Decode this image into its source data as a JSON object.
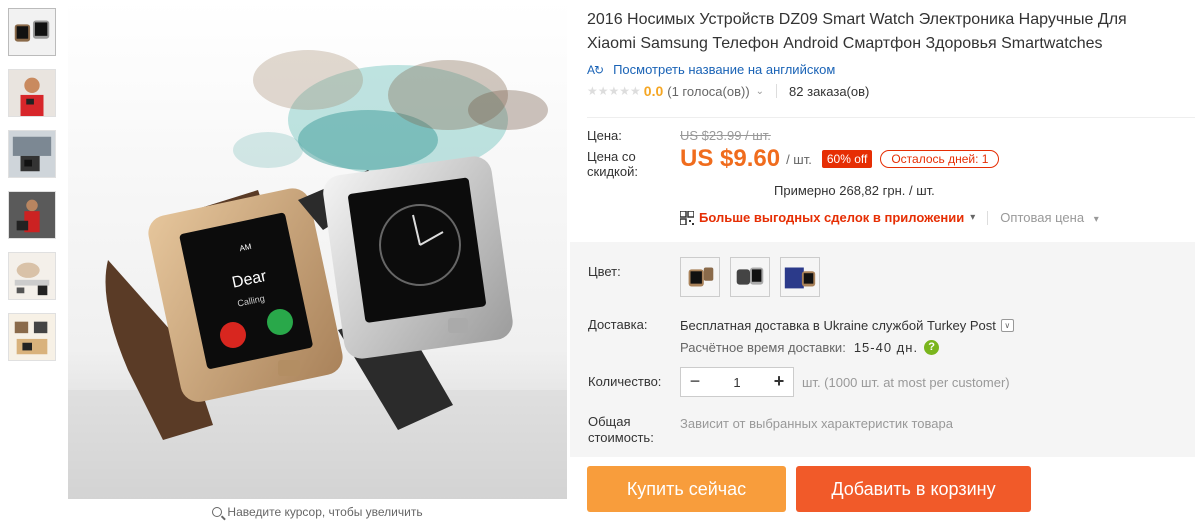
{
  "product": {
    "title": "2016 Носимых Устройств DZ09 Smart Watch Электроника Наручные Для Xiaomi Samsung Телефон Android Смартфон Здоровья Smartwatches",
    "translate_link": "Посмотреть название на английском",
    "translate_icon": "translate-icon"
  },
  "rating": {
    "score": "0.0",
    "votes": "(1 голоса(ов))",
    "orders": "82 заказа(ов)"
  },
  "price": {
    "label_price": "Цена:",
    "old_price": "US $23.99 / шт.",
    "label_discount": "Цена со скидкой:",
    "new_price": "US $9.60",
    "per_unit": "/ шт.",
    "discount_badge": "60% off",
    "days_left": "Осталось дней: 1",
    "approx": "Примерно 268,82 грн. / шт.",
    "app_deals": "Больше выгодных сделок в приложении",
    "wholesale": "Оптовая цена"
  },
  "options": {
    "color_label": "Цвет:",
    "shipping_label": "Доставка:",
    "shipping_text": "Бесплатная доставка в Ukraine службой Turkey Post",
    "delivery_time_label": "Расчётное время доставки:",
    "delivery_time_value": "15-40 дн.",
    "quantity_label": "Количество:",
    "quantity_value": "1",
    "quantity_note": "шт. (1000 шт. at most per customer)",
    "total_label": "Общая стоимость:",
    "total_text": "Зависит от выбранных характеристик товара"
  },
  "actions": {
    "buy_now": "Купить сейчас",
    "add_to_cart": "Добавить в корзину"
  },
  "gallery": {
    "zoom_hint": "Наведите курсор, чтобы увеличить",
    "watch_brand_text": "Dear",
    "watch_call_text": "Calling",
    "watch_status": "AM"
  },
  "colors": {
    "price_orange": "#f06c1d",
    "badge_red": "#e62e04",
    "buy_button": "#f89d3c",
    "cart_button": "#f15a29",
    "link_blue": "#1a63b6"
  }
}
